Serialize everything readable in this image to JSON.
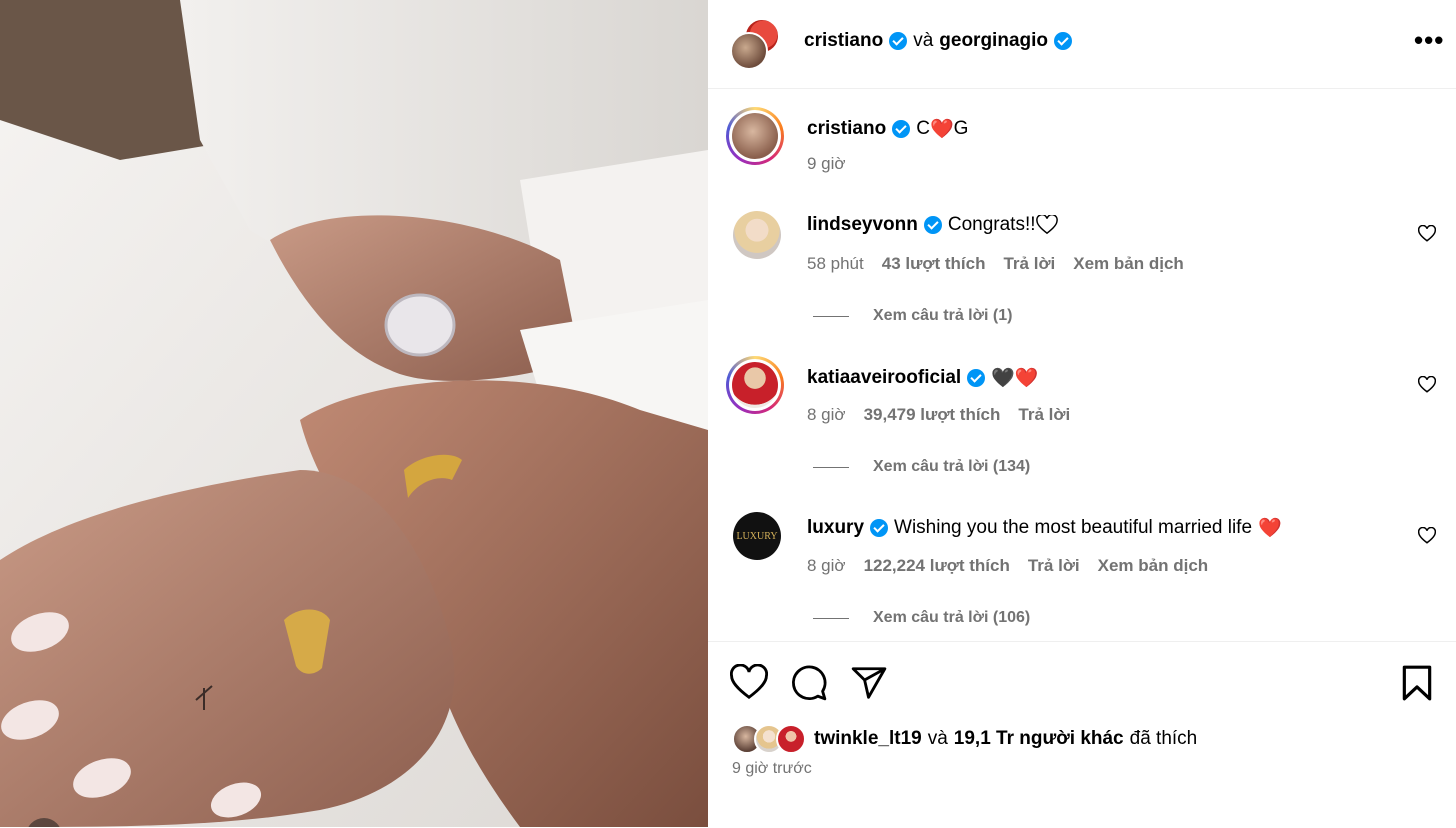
{
  "post": {
    "photo_alt": "hands-with-rings",
    "header": {
      "author_1": "cristiano",
      "connector": "và",
      "author_2": "georginagio",
      "more_icon": "more-horizontal-icon"
    },
    "caption": {
      "username": "cristiano",
      "text_before": "C",
      "heart": "❤️",
      "text_after": "G",
      "time": "9 giờ"
    },
    "comments": [
      {
        "username": "lindseyvonn",
        "text": "Congrats!!",
        "time": "58 phút",
        "likes": "43 lượt thích",
        "reply": "Trả lời",
        "translate": "Xem bản dịch",
        "view_replies": "Xem câu trả lời (1)"
      },
      {
        "username": "katiaaveirooficial",
        "text": "🖤❤️",
        "time": "8 giờ",
        "likes": "39,479 lượt thích",
        "reply": "Trả lời",
        "view_replies": "Xem câu trả lời (134)"
      },
      {
        "username": "luxury",
        "text": "Wishing you the most beautiful married life",
        "heart": "❤️",
        "time": "8 giờ",
        "likes": "122,224 lượt thích",
        "reply": "Trả lời",
        "translate": "Xem bản dịch",
        "view_replies": "Xem câu trả lời (106)",
        "avatar_text": "LUXURY"
      }
    ],
    "likes_summary": {
      "user": "twinkle_lt19",
      "connector": "và",
      "others": "19,1 Tr người khác",
      "suffix": "đã thích"
    },
    "posted": "9 giờ trước"
  },
  "colors": {
    "verified": "#0095f6",
    "muted": "#737373",
    "heart_red": "#ed1c24"
  }
}
